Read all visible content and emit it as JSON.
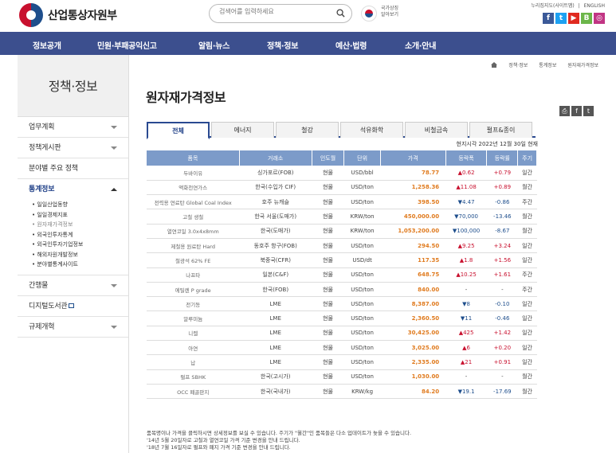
{
  "header": {
    "logo_text": "산업통상자원부",
    "search_placeholder": "검색어를 입력하세요",
    "flag_text_1": "국가상징",
    "flag_text_2": "알아보기",
    "util_links": [
      "누리집지도(사이트맵)",
      "|",
      "ENGLISH"
    ],
    "social": [
      {
        "name": "facebook",
        "label": "f",
        "color": "#3b5998"
      },
      {
        "name": "twitter",
        "label": "t",
        "color": "#1da1f2"
      },
      {
        "name": "youtube",
        "label": "▶",
        "color": "#e02a20"
      },
      {
        "name": "blog",
        "label": "B",
        "color": "#6cb64a"
      },
      {
        "name": "instagram",
        "label": "◎",
        "color": "#c13584"
      }
    ]
  },
  "nav": [
    "정보공개",
    "민원·부패공익신고",
    "알림·뉴스",
    "정책·정보",
    "예산·법령",
    "소개·안내"
  ],
  "sidebar": {
    "title": "정책·정보",
    "items": [
      "업무계획",
      "정책게시판",
      "분야별 주요 정책",
      "통계정보",
      "간행물",
      "디지털도서관",
      "규제개혁"
    ],
    "sub_items": [
      "일일산업동향",
      "일일경제지표",
      "원자재가격정보",
      "외국인투자통계",
      "외국인투자기업정보",
      "해외자원개발정보",
      "분야별통계사이트"
    ]
  },
  "breadcrumb": [
    "정책·정보",
    "통계정보",
    "원자재가격정보"
  ],
  "page_title": "원자재가격정보",
  "tabs": [
    "전체",
    "에너지",
    "철강",
    "석유화학",
    "비철금속",
    "펄프&종이"
  ],
  "as_of": "현지시각 2022년 12월 30일 현재",
  "table": {
    "headers": [
      "품목",
      "거래소",
      "인도월",
      "단위",
      "가격",
      "등락폭",
      "등락률",
      "주기"
    ],
    "rows": [
      {
        "name": "두바이유",
        "exchange": "싱가포르(FOB)",
        "delivery": "현물",
        "unit": "USD/bbl",
        "price": "78.77",
        "change": "▲0.62",
        "rate": "+0.79",
        "period": "일간",
        "dir": "up"
      },
      {
        "name": "액화천연가스",
        "exchange": "한국(수입가 CIF)",
        "delivery": "현물",
        "unit": "USD/ton",
        "price": "1,258.36",
        "change": "▲11.08",
        "rate": "+0.89",
        "period": "월간",
        "dir": "up"
      },
      {
        "name": "전력용 연료탄 Global Coal Index",
        "exchange": "호주 뉴캐슬",
        "delivery": "현물",
        "unit": "USD/ton",
        "price": "398.50",
        "change": "▼4.47",
        "rate": "-0.86",
        "period": "주간",
        "dir": "down"
      },
      {
        "name": "고철 생철",
        "exchange": "한국 서울(도매가)",
        "delivery": "현물",
        "unit": "KRW/ton",
        "price": "450,000.00",
        "change": "▼70,000",
        "rate": "-13.46",
        "period": "월간",
        "dir": "down"
      },
      {
        "name": "열연코일 3.0x4x8mm",
        "exchange": "한국(도매가)",
        "delivery": "현물",
        "unit": "KRW/ton",
        "price": "1,053,200.00",
        "change": "▼100,000",
        "rate": "-8.67",
        "period": "월간",
        "dir": "down"
      },
      {
        "name": "제철용 원료탄 Hard",
        "exchange": "동호주 항구(FOB)",
        "delivery": "현물",
        "unit": "USD/ton",
        "price": "294.50",
        "change": "▲9.25",
        "rate": "+3.24",
        "period": "일간",
        "dir": "up"
      },
      {
        "name": "철광석 62% FE",
        "exchange": "북중국(CFR)",
        "delivery": "현물",
        "unit": "USD/dt",
        "price": "117.35",
        "change": "▲1.8",
        "rate": "+1.56",
        "period": "일간",
        "dir": "up"
      },
      {
        "name": "나프타",
        "exchange": "일본(C&F)",
        "delivery": "현물",
        "unit": "USD/ton",
        "price": "648.75",
        "change": "▲10.25",
        "rate": "+1.61",
        "period": "주간",
        "dir": "up"
      },
      {
        "name": "에틸렌 P grade",
        "exchange": "한국(FOB)",
        "delivery": "현물",
        "unit": "USD/ton",
        "price": "840.00",
        "change": "-",
        "rate": "-",
        "period": "주간",
        "dir": "none"
      },
      {
        "name": "전기동",
        "exchange": "LME",
        "delivery": "현물",
        "unit": "USD/ton",
        "price": "8,387.00",
        "change": "▼8",
        "rate": "-0.10",
        "period": "일간",
        "dir": "down"
      },
      {
        "name": "알루미늄",
        "exchange": "LME",
        "delivery": "현물",
        "unit": "USD/ton",
        "price": "2,360.50",
        "change": "▼11",
        "rate": "-0.46",
        "period": "일간",
        "dir": "down"
      },
      {
        "name": "니켈",
        "exchange": "LME",
        "delivery": "현물",
        "unit": "USD/ton",
        "price": "30,425.00",
        "change": "▲425",
        "rate": "+1.42",
        "period": "일간",
        "dir": "up"
      },
      {
        "name": "아연",
        "exchange": "LME",
        "delivery": "현물",
        "unit": "USD/ton",
        "price": "3,025.00",
        "change": "▲6",
        "rate": "+0.20",
        "period": "일간",
        "dir": "up"
      },
      {
        "name": "납",
        "exchange": "LME",
        "delivery": "현물",
        "unit": "USD/ton",
        "price": "2,335.00",
        "change": "▲21",
        "rate": "+0.91",
        "period": "일간",
        "dir": "up"
      },
      {
        "name": "펄프 SBHK",
        "exchange": "한국(고시가)",
        "delivery": "현물",
        "unit": "USD/ton",
        "price": "1,030.00",
        "change": "-",
        "rate": "-",
        "period": "월간",
        "dir": "none"
      },
      {
        "name": "OCC 폐골판지",
        "exchange": "한국(국내가)",
        "delivery": "현물",
        "unit": "KRW/kg",
        "price": "84.20",
        "change": "▼19.1",
        "rate": "-17.69",
        "period": "월간",
        "dir": "down"
      }
    ]
  },
  "notes": [
    "품목명이나 가격을 클릭하시면 상세정보를 보실 수 있습니다. 주기가 \"월간\"인 품목들은 다소 업데이트가 늦을 수 있습니다.",
    "'14년 5월 20일자로 고철과 열연코일 가격 기준 변경을 안내 드립니다.",
    "'18년 7월 16일자로 펄프와 폐지 가격 기준 변경을 안내 드립니다."
  ]
}
